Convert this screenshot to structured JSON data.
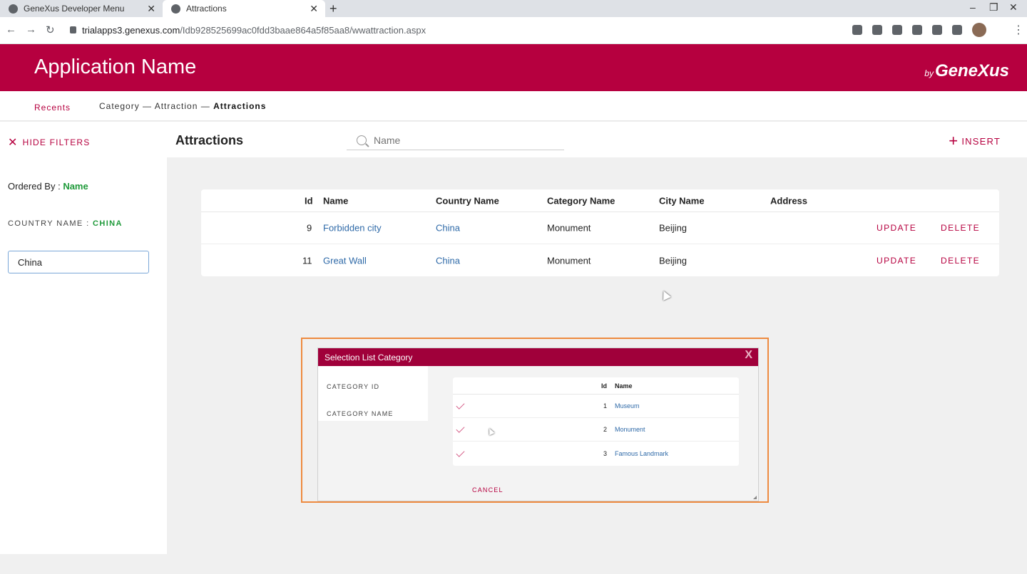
{
  "browser": {
    "tabs": [
      {
        "label": "GeneXus Developer Menu",
        "active": false
      },
      {
        "label": "Attractions",
        "active": true
      }
    ],
    "url_host": "trialapps3.genexus.com",
    "url_path": "/Idb928525699ac0fdd3baae864a5f85aa8/wwattraction.aspx"
  },
  "header": {
    "app_title": "Application Name",
    "brand_prefix": "by",
    "brand_name": "GeneXus"
  },
  "breadcrumb": {
    "recents": "Recents",
    "path": "Category — Attraction — ",
    "current": "Attractions"
  },
  "toolbar": {
    "hide_filters": "HIDE FILTERS",
    "title": "Attractions",
    "search_placeholder": "Name",
    "insert": "INSERT"
  },
  "filters": {
    "ordered_by_label": "Ordered By : ",
    "ordered_by_value": "Name",
    "country_label": "COUNTRY NAME : ",
    "country_value": "CHINA",
    "country_input": "China"
  },
  "grid": {
    "columns": [
      "Id",
      "Name",
      "Country Name",
      "Category Name",
      "City Name",
      "Address"
    ],
    "rows": [
      {
        "id": "9",
        "name": "Forbidden city",
        "country": "China",
        "category": "Monument",
        "city": "Beijing",
        "address": "",
        "update": "UPDATE",
        "delete": "DELETE"
      },
      {
        "id": "11",
        "name": "Great Wall",
        "country": "China",
        "category": "Monument",
        "city": "Beijing",
        "address": "",
        "update": "UPDATE",
        "delete": "DELETE"
      }
    ]
  },
  "popup": {
    "title": "Selection List Category",
    "close": "X",
    "filter_labels": [
      "CATEGORY ID",
      "CATEGORY NAME"
    ],
    "columns": [
      "Id",
      "Name"
    ],
    "rows": [
      {
        "id": "1",
        "name": "Museum"
      },
      {
        "id": "2",
        "name": "Monument"
      },
      {
        "id": "3",
        "name": "Famous Landmark"
      }
    ],
    "cancel": "CANCEL"
  },
  "colors": {
    "brand": "#b6003f",
    "popup_header": "#a0003a",
    "highlight": "#ee8a3f",
    "link": "#2f6aa8",
    "accent_green": "#1f9a3a"
  }
}
